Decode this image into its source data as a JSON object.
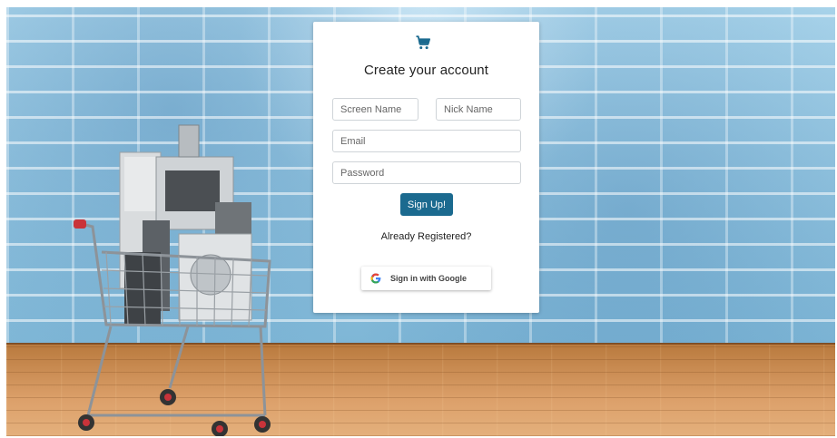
{
  "brand": {
    "icon": "shopping-cart-icon",
    "accent": "#1b6a8f"
  },
  "form": {
    "title": "Create your account",
    "screen_name_placeholder": "Screen Name",
    "nick_name_placeholder": "Nick Name",
    "email_placeholder": "Email",
    "password_placeholder": "Password",
    "signup_label": "Sign Up!",
    "already_registered": "Already Registered?",
    "google_label": "Sign in with Google",
    "google_icon": "google-g-icon"
  }
}
